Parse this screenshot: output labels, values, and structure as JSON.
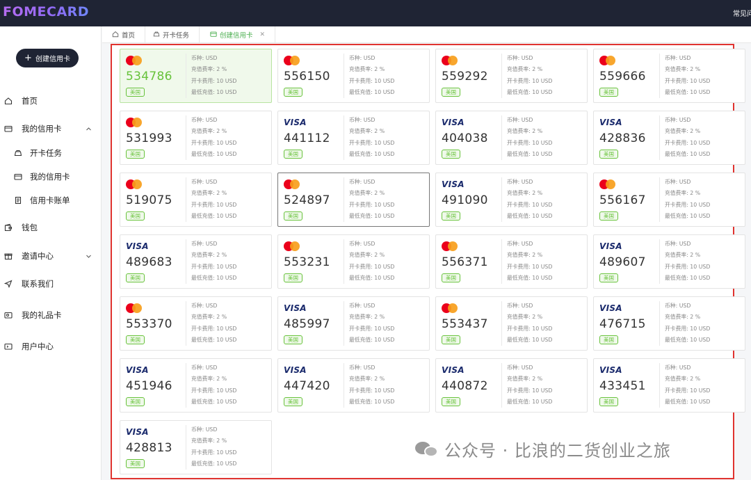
{
  "app": {
    "logo": "FOMECARD",
    "top_right": "常见问题"
  },
  "sidebar": {
    "create_button": "创建信用卡",
    "items": [
      {
        "label": "首页",
        "icon": "home-icon"
      },
      {
        "label": "我的信用卡",
        "icon": "credit-card-icon"
      },
      {
        "label": "开卡任务",
        "icon": "task-icon"
      },
      {
        "label": "我的信用卡",
        "icon": "card-icon"
      },
      {
        "label": "信用卡账单",
        "icon": "bill-icon"
      },
      {
        "label": "钱包",
        "icon": "wallet-icon"
      },
      {
        "label": "邀请中心",
        "icon": "gift-box-icon"
      },
      {
        "label": "联系我们",
        "icon": "send-icon"
      },
      {
        "label": "我的礼品卡",
        "icon": "gift-card-icon"
      },
      {
        "label": "用户中心",
        "icon": "user-center-icon"
      }
    ]
  },
  "tabs": [
    {
      "label": "首页"
    },
    {
      "label": "开卡任务"
    },
    {
      "label": "创建信用卡"
    }
  ],
  "card_labels": {
    "currency": "币种: USD",
    "fee_rate": "充值费率: 2 %",
    "open_fee": "开卡费用: 10 USD",
    "min_topup": "最低充值: 10 USD",
    "region": "美国"
  },
  "visa_text": "VISA",
  "cards": [
    {
      "bin": "534786",
      "brand": "mastercard"
    },
    {
      "bin": "556150",
      "brand": "mastercard"
    },
    {
      "bin": "559292",
      "brand": "mastercard"
    },
    {
      "bin": "559666",
      "brand": "mastercard"
    },
    {
      "bin": "531993",
      "brand": "mastercard"
    },
    {
      "bin": "441112",
      "brand": "visa"
    },
    {
      "bin": "404038",
      "brand": "visa"
    },
    {
      "bin": "428836",
      "brand": "visa"
    },
    {
      "bin": "519075",
      "brand": "mastercard"
    },
    {
      "bin": "524897",
      "brand": "mastercard"
    },
    {
      "bin": "491090",
      "brand": "visa"
    },
    {
      "bin": "556167",
      "brand": "mastercard"
    },
    {
      "bin": "489683",
      "brand": "visa"
    },
    {
      "bin": "553231",
      "brand": "mastercard"
    },
    {
      "bin": "556371",
      "brand": "mastercard"
    },
    {
      "bin": "489607",
      "brand": "visa"
    },
    {
      "bin": "553370",
      "brand": "mastercard"
    },
    {
      "bin": "485997",
      "brand": "visa"
    },
    {
      "bin": "553437",
      "brand": "mastercard"
    },
    {
      "bin": "476715",
      "brand": "visa"
    },
    {
      "bin": "451946",
      "brand": "visa"
    },
    {
      "bin": "447420",
      "brand": "visa"
    },
    {
      "bin": "440872",
      "brand": "visa"
    },
    {
      "bin": "433451",
      "brand": "visa"
    },
    {
      "bin": "428813",
      "brand": "visa"
    }
  ],
  "watermark": "公众号 · 比浪的二货创业之旅"
}
